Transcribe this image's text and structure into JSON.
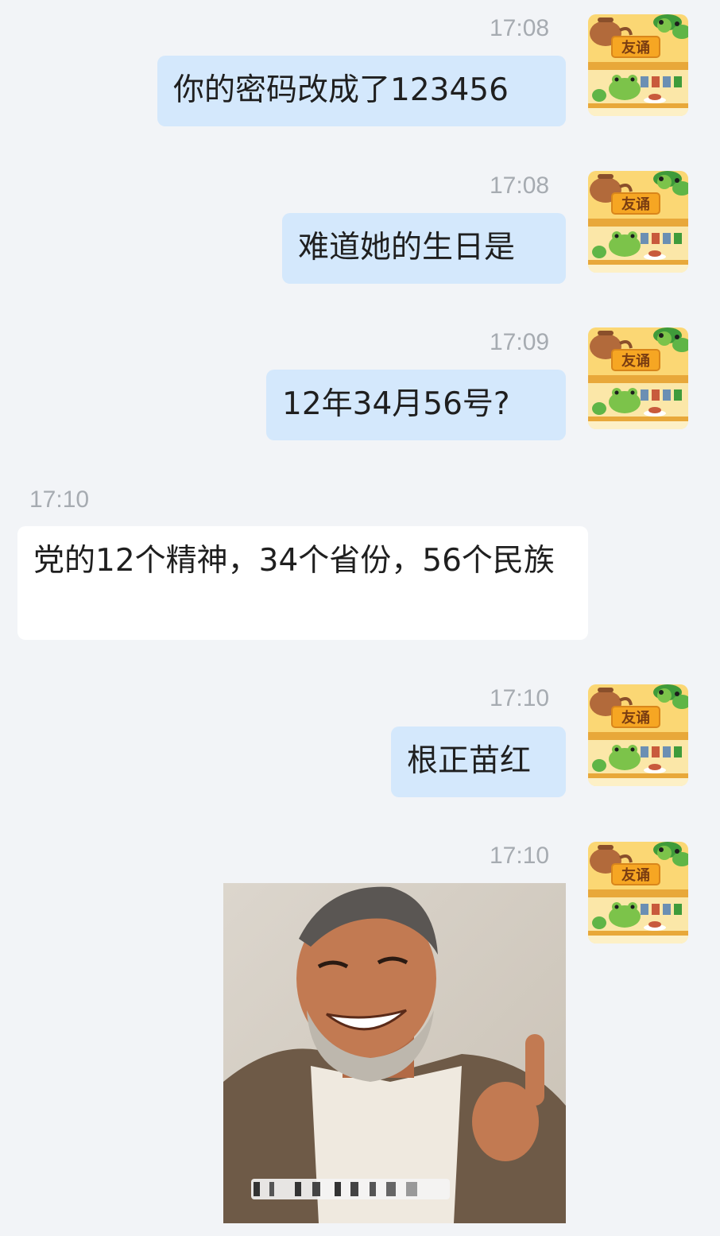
{
  "messages": [
    {
      "sender": "me",
      "time": "17:08",
      "text": "你的密码改成了123456",
      "avatar": "frog-shop-avatar"
    },
    {
      "sender": "me",
      "time": "17:08",
      "text": "难道她的生日是",
      "avatar": "frog-shop-avatar"
    },
    {
      "sender": "me",
      "time": "17:09",
      "text": "12年34月56号?",
      "avatar": "frog-shop-avatar"
    },
    {
      "sender": "other",
      "time": "17:10",
      "text": "党的12个精神，34个省份，56个民族"
    },
    {
      "sender": "me",
      "time": "17:10",
      "text": "根正苗红",
      "avatar": "frog-shop-avatar"
    },
    {
      "sender": "me",
      "time": "17:10",
      "image": "laughing-old-man-thumbs-up-meme",
      "avatar": "frog-shop-avatar"
    }
  ],
  "avatar": {
    "sign_text": "友诵",
    "colors": {
      "sign": "#f6a623",
      "frog": "#7cc34a",
      "shelf": "#f4c55a",
      "leaf": "#3f9b3a"
    }
  },
  "colors": {
    "background": "#f2f4f7",
    "my_bubble": "#d4e8fc",
    "other_bubble": "#ffffff",
    "timestamp": "#a6abb1",
    "text": "#1f1f1f"
  }
}
